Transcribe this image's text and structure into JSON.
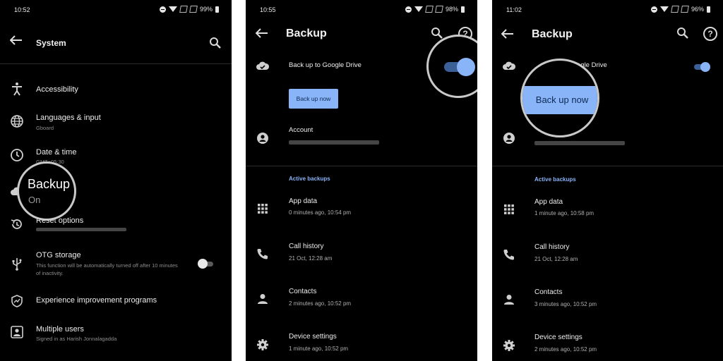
{
  "panel1": {
    "status": {
      "time": "10:52",
      "battery": "99%"
    },
    "title": "System",
    "items": [
      {
        "label": "Accessibility",
        "sub": ""
      },
      {
        "label": "Languages & input",
        "sub": "Gboard"
      },
      {
        "label": "Date & time",
        "sub": "GMT+05:30"
      },
      {
        "label": "Backup",
        "sub": "On"
      },
      {
        "label": "Reset options",
        "sub": ""
      },
      {
        "label": "OTG storage",
        "sub": "This function will be automatically turned off after 10 minutes of inactivity."
      },
      {
        "label": "Experience improvement programs",
        "sub": ""
      },
      {
        "label": "Multiple users",
        "sub": "Signed in as Harish Jonnalagadda"
      }
    ],
    "magnifier": {
      "label": "Backup",
      "sub": "On"
    }
  },
  "panel2": {
    "status": {
      "time": "10:55",
      "battery": "98%"
    },
    "title": "Backup",
    "backup_drive_label": "Back up to Google Drive",
    "backup_now_label": "Back up now",
    "account_label": "Account",
    "section_label": "Active backups",
    "backups": [
      {
        "label": "App data",
        "sub": "0 minutes ago, 10:54 pm"
      },
      {
        "label": "Call history",
        "sub": "21 Oct, 12:28 am"
      },
      {
        "label": "Contacts",
        "sub": "2 minutes ago, 10:52 pm"
      },
      {
        "label": "Device settings",
        "sub": "1 minute ago, 10:52 pm"
      }
    ]
  },
  "panel3": {
    "status": {
      "time": "11:02",
      "battery": "96%"
    },
    "title": "Backup",
    "backup_drive_label": "ogle Drive",
    "backup_now_label": "Back up now",
    "section_label": "Active backups",
    "backups": [
      {
        "label": "App data",
        "sub": "1 minute ago, 10:58 pm"
      },
      {
        "label": "Call history",
        "sub": "21 Oct, 12:28 am"
      },
      {
        "label": "Contacts",
        "sub": "3 minutes ago, 10:52 pm"
      },
      {
        "label": "Device settings",
        "sub": "2 minutes ago, 10:52 pm"
      }
    ]
  },
  "colors": {
    "accent": "#8ab4f8",
    "background": "#000000",
    "text": "#ededed"
  },
  "icons": [
    "back-arrow-icon",
    "search-icon",
    "help-icon",
    "accessibility-icon",
    "globe-icon",
    "clock-icon",
    "cloud-icon",
    "restore-icon",
    "usb-icon",
    "shield-icon",
    "users-icon",
    "cloud-done-icon",
    "account-circle-icon",
    "apps-grid-icon",
    "phone-icon",
    "person-icon",
    "gear-icon"
  ]
}
